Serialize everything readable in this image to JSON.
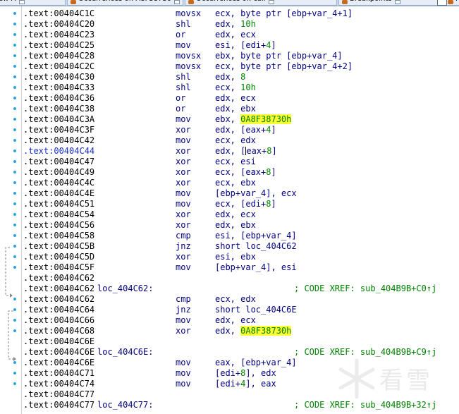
{
  "tabs": [
    {
      "label": "...-View-A",
      "has_close": true
    },
    {
      "label": "Occurrences of: A8F38730",
      "has_close": true
    },
    {
      "label": "Occurrences of: call",
      "has_close": true
    },
    {
      "label": "Breakpoints",
      "has_close": true
    },
    {
      "label": "He",
      "has_close": false
    }
  ],
  "highlight_color": "#ffff33",
  "listing": {
    "rows": [
      {
        "addr": ".text:00404C1C",
        "label": "",
        "mnem": "movsx",
        "ops": [
          {
            "t": "ecx, byte ptr [ebp+var_4+1]"
          }
        ],
        "comment": ""
      },
      {
        "addr": ".text:00404C20",
        "label": "",
        "mnem": "shl",
        "ops": [
          {
            "t": "edx, "
          },
          {
            "t": "10h",
            "num": true
          }
        ],
        "comment": ""
      },
      {
        "addr": ".text:00404C23",
        "label": "",
        "mnem": "or",
        "ops": [
          {
            "t": "edx, ecx"
          }
        ],
        "comment": ""
      },
      {
        "addr": ".text:00404C25",
        "label": "",
        "mnem": "mov",
        "ops": [
          {
            "t": "esi, [edi+"
          },
          {
            "t": "4",
            "num": true
          },
          {
            "t": "]"
          }
        ],
        "comment": ""
      },
      {
        "addr": ".text:00404C28",
        "label": "",
        "mnem": "movsx",
        "ops": [
          {
            "t": "ebx, byte ptr [ebp+var_4]"
          }
        ],
        "comment": ""
      },
      {
        "addr": ".text:00404C2C",
        "label": "",
        "mnem": "movsx",
        "ops": [
          {
            "t": "ecx, byte ptr [ebp+var_4+2]"
          }
        ],
        "comment": ""
      },
      {
        "addr": ".text:00404C30",
        "label": "",
        "mnem": "shl",
        "ops": [
          {
            "t": "edx, "
          },
          {
            "t": "8",
            "num": true
          }
        ],
        "comment": ""
      },
      {
        "addr": ".text:00404C33",
        "label": "",
        "mnem": "shl",
        "ops": [
          {
            "t": "ecx, "
          },
          {
            "t": "10h",
            "num": true
          }
        ],
        "comment": ""
      },
      {
        "addr": ".text:00404C36",
        "label": "",
        "mnem": "or",
        "ops": [
          {
            "t": "edx, ecx"
          }
        ],
        "comment": ""
      },
      {
        "addr": ".text:00404C38",
        "label": "",
        "mnem": "or",
        "ops": [
          {
            "t": "edx, ebx"
          }
        ],
        "comment": ""
      },
      {
        "addr": ".text:00404C3A",
        "label": "",
        "mnem": "mov",
        "ops": [
          {
            "t": "ebx, "
          },
          {
            "t": "0A8F38730h",
            "hl": true
          }
        ],
        "comment": ""
      },
      {
        "addr": ".text:00404C3F",
        "label": "",
        "mnem": "xor",
        "ops": [
          {
            "t": "edx, [eax+"
          },
          {
            "t": "4",
            "num": true
          },
          {
            "t": "]"
          }
        ],
        "comment": ""
      },
      {
        "addr": ".text:00404C42",
        "label": "",
        "mnem": "mov",
        "ops": [
          {
            "t": "ecx, edx"
          }
        ],
        "comment": ""
      },
      {
        "addr": ".text:00404C44",
        "label": "",
        "mnem": "xor",
        "focus": true,
        "ops": [
          {
            "t": "edx, ["
          },
          {
            "caret": true
          },
          {
            "t": "eax+"
          },
          {
            "t": "8",
            "num": true
          },
          {
            "t": "]"
          }
        ],
        "comment": ""
      },
      {
        "addr": ".text:00404C47",
        "label": "",
        "mnem": "xor",
        "ops": [
          {
            "t": "ecx, esi"
          }
        ],
        "comment": ""
      },
      {
        "addr": ".text:00404C49",
        "label": "",
        "mnem": "xor",
        "ops": [
          {
            "t": "ecx, [eax+"
          },
          {
            "t": "8",
            "num": true
          },
          {
            "t": "]"
          }
        ],
        "comment": ""
      },
      {
        "addr": ".text:00404C4C",
        "label": "",
        "mnem": "xor",
        "ops": [
          {
            "t": "ecx, ebx"
          }
        ],
        "comment": ""
      },
      {
        "addr": ".text:00404C4E",
        "label": "",
        "mnem": "mov",
        "ops": [
          {
            "t": "[ebp+var_4], ecx"
          }
        ],
        "comment": ""
      },
      {
        "addr": ".text:00404C51",
        "label": "",
        "mnem": "mov",
        "ops": [
          {
            "t": "ecx, [edi+"
          },
          {
            "t": "8",
            "num": true
          },
          {
            "t": "]"
          }
        ],
        "comment": ""
      },
      {
        "addr": ".text:00404C54",
        "label": "",
        "mnem": "xor",
        "ops": [
          {
            "t": "edx, ecx"
          }
        ],
        "comment": ""
      },
      {
        "addr": ".text:00404C56",
        "label": "",
        "mnem": "xor",
        "ops": [
          {
            "t": "edx, ebx"
          }
        ],
        "comment": ""
      },
      {
        "addr": ".text:00404C58",
        "label": "",
        "mnem": "cmp",
        "ops": [
          {
            "t": "esi, [ebp+var_4]"
          }
        ],
        "comment": ""
      },
      {
        "addr": ".text:00404C5B",
        "label": "",
        "mnem": "jnz",
        "ops": [
          {
            "t": "short loc_404C62"
          }
        ],
        "comment": ""
      },
      {
        "addr": ".text:00404C5D",
        "label": "",
        "mnem": "xor",
        "ops": [
          {
            "t": "esi, ebx"
          }
        ],
        "comment": ""
      },
      {
        "addr": ".text:00404C5F",
        "label": "",
        "mnem": "mov",
        "ops": [
          {
            "t": "[ebp+var_4], esi"
          }
        ],
        "comment": ""
      },
      {
        "addr": ".text:00404C62",
        "label": "",
        "mnem": "",
        "ops": [],
        "comment": ""
      },
      {
        "addr": ".text:00404C62",
        "label": "loc_404C62:",
        "mnem": "",
        "ops": [],
        "comment": "; CODE XREF: sub_404B9B+C0↑j"
      },
      {
        "addr": ".text:00404C62",
        "label": "",
        "mnem": "cmp",
        "ops": [
          {
            "t": "ecx, edx"
          }
        ],
        "comment": ""
      },
      {
        "addr": ".text:00404C64",
        "label": "",
        "mnem": "jnz",
        "ops": [
          {
            "t": "short loc_404C6E"
          }
        ],
        "comment": ""
      },
      {
        "addr": ".text:00404C66",
        "label": "",
        "mnem": "mov",
        "ops": [
          {
            "t": "edx, ecx"
          }
        ],
        "comment": ""
      },
      {
        "addr": ".text:00404C68",
        "label": "",
        "mnem": "xor",
        "ops": [
          {
            "t": "edx, "
          },
          {
            "t": "0A8F38730h",
            "hl": true
          }
        ],
        "comment": ""
      },
      {
        "addr": ".text:00404C6E",
        "label": "",
        "mnem": "",
        "ops": [],
        "comment": ""
      },
      {
        "addr": ".text:00404C6E",
        "label": "loc_404C6E:",
        "mnem": "",
        "ops": [],
        "comment": "; CODE XREF: sub_404B9B+C9↑j"
      },
      {
        "addr": ".text:00404C6E",
        "label": "",
        "mnem": "mov",
        "ops": [
          {
            "t": "eax, [ebp+var_4]"
          }
        ],
        "comment": ""
      },
      {
        "addr": ".text:00404C71",
        "label": "",
        "mnem": "mov",
        "ops": [
          {
            "t": "[edi+"
          },
          {
            "t": "8",
            "num": true
          },
          {
            "t": "], edx"
          }
        ],
        "comment": ""
      },
      {
        "addr": ".text:00404C74",
        "label": "",
        "mnem": "mov",
        "ops": [
          {
            "t": "[edi+"
          },
          {
            "t": "4",
            "num": true
          },
          {
            "t": "], eax"
          }
        ],
        "comment": ""
      },
      {
        "addr": ".text:00404C77",
        "label": "",
        "mnem": "",
        "ops": [],
        "comment": ""
      },
      {
        "addr": ".text:00404C77",
        "label": "loc_404C77:",
        "mnem": "",
        "ops": [],
        "comment": "; CODE XREF: sub_404B9B+32↑j"
      }
    ]
  },
  "breakpoint_rows": [
    0,
    1,
    2,
    3,
    4,
    5,
    6,
    7,
    8,
    9,
    10,
    11,
    12,
    13,
    14,
    15,
    16,
    17,
    18,
    19,
    20,
    21,
    22,
    23,
    24,
    27,
    28,
    29,
    30,
    33,
    34,
    35
  ],
  "watermark": {
    "text": "看雪"
  }
}
